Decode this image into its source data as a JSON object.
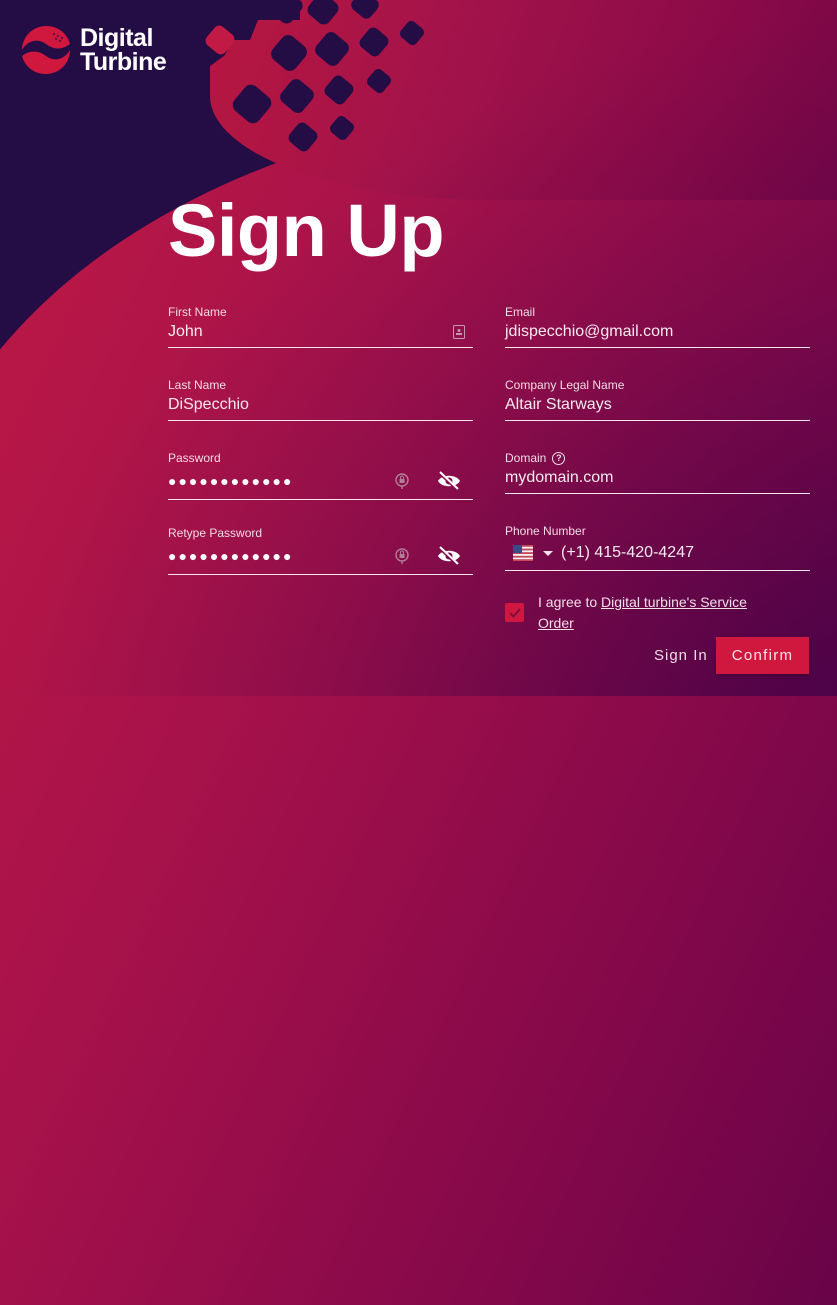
{
  "brand": {
    "name_line1": "Digital",
    "name_line2": "Turbine",
    "colors": {
      "primary": "#d0183f",
      "background_dark": "#240c45",
      "gradient_start": "#c01a45",
      "gradient_end": "#4c0346"
    }
  },
  "page": {
    "title": "Sign Up"
  },
  "form": {
    "first_name": {
      "label": "First Name",
      "value": "John",
      "icon": "contact-card-icon"
    },
    "last_name": {
      "label": "Last Name",
      "value": "DiSpecchio"
    },
    "password": {
      "label": "Password",
      "value": "●●●●●●●●●●●●",
      "icons": [
        "password-manager-key-icon",
        "eye-slash-icon"
      ]
    },
    "retype_password": {
      "label": "Retype Password",
      "value": "●●●●●●●●●●●●",
      "icons": [
        "password-manager-key-icon",
        "eye-slash-icon"
      ]
    },
    "email": {
      "label": "Email",
      "value": "jdispecchio@gmail.com"
    },
    "company": {
      "label": "Company Legal Name",
      "value": "Altair Starways"
    },
    "domain": {
      "label": "Domain",
      "value": "mydomain.com",
      "help_icon": "?"
    },
    "phone": {
      "label": "Phone Number",
      "country": "US",
      "value": "(+1) 415-420-4247"
    },
    "agree": {
      "checked": true,
      "prefix": "I agree to ",
      "link_text": "Digital turbine's Service Order"
    }
  },
  "actions": {
    "sign_in": "Sign In",
    "confirm": "Confirm"
  }
}
